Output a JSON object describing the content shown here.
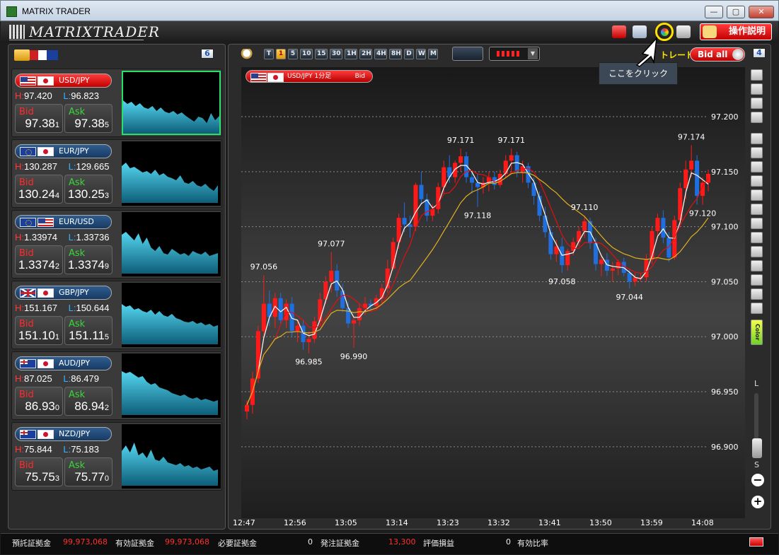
{
  "window": {
    "title": "MATRIX TRADER"
  },
  "toolbar": {
    "logo": "MATRIXTRADER",
    "help_label": "操作説明"
  },
  "left_panel": {
    "badge": "6"
  },
  "pairs": [
    {
      "symbol": "USD/JPY",
      "high": "97.420",
      "low": "96.823",
      "bid_main": "97.38",
      "bid_pip": "1",
      "ask_main": "97.38",
      "ask_pip": "5",
      "active": true
    },
    {
      "symbol": "EUR/JPY",
      "high": "130.287",
      "low": "129.665",
      "bid_main": "130.24",
      "bid_pip": "4",
      "ask_main": "130.25",
      "ask_pip": "3"
    },
    {
      "symbol": "EUR/USD",
      "high": "1.33974",
      "low": "1.33736",
      "bid_main": "1.3374",
      "bid_pip": "2",
      "ask_main": "1.3374",
      "ask_pip": "9"
    },
    {
      "symbol": "GBP/JPY",
      "high": "151.167",
      "low": "150.644",
      "bid_main": "151.10",
      "bid_pip": "1",
      "ask_main": "151.11",
      "ask_pip": "5"
    },
    {
      "symbol": "AUD/JPY",
      "high": "87.025",
      "low": "86.479",
      "bid_main": "86.93",
      "bid_pip": "0",
      "ask_main": "86.94",
      "ask_pip": "2"
    },
    {
      "symbol": "NZD/JPY",
      "high": "75.844",
      "low": "75.183",
      "bid_main": "75.75",
      "bid_pip": "3",
      "ask_main": "75.77",
      "ask_pip": "0"
    }
  ],
  "labels": {
    "h": "H:",
    "l": "L:",
    "bid": "Bid",
    "ask": "Ask"
  },
  "chart_panel": {
    "timeframes": [
      "T",
      "1",
      "5",
      "10",
      "15",
      "30",
      "1H",
      "2H",
      "4H",
      "8H",
      "D",
      "W",
      "M"
    ],
    "active_timeframe": "1",
    "pair_tag": "USD/JPY 1分足",
    "pair_tag_side": "Bid",
    "trade_label": "トレード",
    "trade_toggle": "Bid all",
    "badge": "4",
    "tooltip": "ここをクリック",
    "zoom_l": "L",
    "zoom_s": "S",
    "color_tool": "Color"
  },
  "chart_data": {
    "type": "candlestick",
    "title": "USD/JPY 1分足",
    "y_ticks": [
      "97.200",
      "97.150",
      "97.100",
      "97.050",
      "97.000",
      "96.950",
      "96.900"
    ],
    "ylim": [
      96.835,
      97.245
    ],
    "x_ticks": [
      "12:47",
      "12:56",
      "13:05",
      "13:14",
      "13:23",
      "13:32",
      "13:41",
      "13:50",
      "13:59",
      "14:08"
    ],
    "annotations": [
      {
        "label": "97.056",
        "value": 97.056,
        "i": 3
      },
      {
        "label": "96.985",
        "value": 96.985,
        "i": 11
      },
      {
        "label": "97.077",
        "value": 97.077,
        "i": 15
      },
      {
        "label": "96.990",
        "value": 96.99,
        "i": 19
      },
      {
        "label": "97.171",
        "value": 97.171,
        "i": 38
      },
      {
        "label": "97.118",
        "value": 97.118,
        "i": 41
      },
      {
        "label": "97.171",
        "value": 97.171,
        "i": 47
      },
      {
        "label": "97.110",
        "value": 97.11,
        "i": 60
      },
      {
        "label": "97.058",
        "value": 97.058,
        "i": 56
      },
      {
        "label": "97.044",
        "value": 97.044,
        "i": 68
      },
      {
        "label": "97.174",
        "value": 97.174,
        "i": 79
      },
      {
        "label": "97.120",
        "value": 97.12,
        "i": 81
      }
    ],
    "candles": [
      [
        96.932,
        96.942,
        96.925,
        96.938
      ],
      [
        96.938,
        96.968,
        96.93,
        96.962
      ],
      [
        96.962,
        97.01,
        96.958,
        97.005
      ],
      [
        97.005,
        97.056,
        97.0,
        97.03
      ],
      [
        97.03,
        97.042,
        97.01,
        97.018
      ],
      [
        97.018,
        97.04,
        97.008,
        97.035
      ],
      [
        97.035,
        97.04,
        97.012,
        97.015
      ],
      [
        97.015,
        97.034,
        97.008,
        97.03
      ],
      [
        97.03,
        97.036,
        97.0,
        97.005
      ],
      [
        97.005,
        97.015,
        96.995,
        97.01
      ],
      [
        97.01,
        97.015,
        96.988,
        96.995
      ],
      [
        96.995,
        97.005,
        96.985,
        96.998
      ],
      [
        96.998,
        97.018,
        96.994,
        97.014
      ],
      [
        97.014,
        97.04,
        97.01,
        97.034
      ],
      [
        97.034,
        97.055,
        97.03,
        97.05
      ],
      [
        97.05,
        97.077,
        97.04,
        97.06
      ],
      [
        97.06,
        97.066,
        97.036,
        97.042
      ],
      [
        97.042,
        97.048,
        97.022,
        97.026
      ],
      [
        97.026,
        97.032,
        97.008,
        97.012
      ],
      [
        97.012,
        97.018,
        96.99,
        97.015
      ],
      [
        97.015,
        97.03,
        97.01,
        97.026
      ],
      [
        97.026,
        97.036,
        97.02,
        97.03
      ],
      [
        97.03,
        97.034,
        97.024,
        97.028
      ],
      [
        97.028,
        97.038,
        97.024,
        97.035
      ],
      [
        97.035,
        97.048,
        97.03,
        97.044
      ],
      [
        97.044,
        97.07,
        97.04,
        97.062
      ],
      [
        97.062,
        97.09,
        97.06,
        97.086
      ],
      [
        97.086,
        97.112,
        97.08,
        97.108
      ],
      [
        97.108,
        97.122,
        97.095,
        97.102
      ],
      [
        97.102,
        97.11,
        97.09,
        97.1
      ],
      [
        97.1,
        97.14,
        97.096,
        97.138
      ],
      [
        97.138,
        97.15,
        97.12,
        97.125
      ],
      [
        97.125,
        97.13,
        97.105,
        97.11
      ],
      [
        97.11,
        97.12,
        97.105,
        97.116
      ],
      [
        97.116,
        97.14,
        97.112,
        97.136
      ],
      [
        97.136,
        97.16,
        97.13,
        97.154
      ],
      [
        97.154,
        97.165,
        97.14,
        97.145
      ],
      [
        97.145,
        97.16,
        97.14,
        97.158
      ],
      [
        97.158,
        97.171,
        97.15,
        97.164
      ],
      [
        97.164,
        97.168,
        97.14,
        97.145
      ],
      [
        97.145,
        97.15,
        97.13,
        97.14
      ],
      [
        97.14,
        97.148,
        97.118,
        97.136
      ],
      [
        97.136,
        97.145,
        97.13,
        97.14
      ],
      [
        97.14,
        97.15,
        97.132,
        97.145
      ],
      [
        97.145,
        97.15,
        97.134,
        97.138
      ],
      [
        97.138,
        97.152,
        97.136,
        97.148
      ],
      [
        97.148,
        97.165,
        97.145,
        97.16
      ],
      [
        97.16,
        97.171,
        97.15,
        97.165
      ],
      [
        97.165,
        97.168,
        97.145,
        97.15
      ],
      [
        97.15,
        97.16,
        97.14,
        97.155
      ],
      [
        97.155,
        97.158,
        97.135,
        97.14
      ],
      [
        97.14,
        97.145,
        97.12,
        97.128
      ],
      [
        97.128,
        97.132,
        97.105,
        97.11
      ],
      [
        97.11,
        97.118,
        97.09,
        97.095
      ],
      [
        97.095,
        97.1,
        97.07,
        97.075
      ],
      [
        97.075,
        97.088,
        97.068,
        97.082
      ],
      [
        97.082,
        97.09,
        97.058,
        97.065
      ],
      [
        97.065,
        97.08,
        97.06,
        97.078
      ],
      [
        97.078,
        97.09,
        97.074,
        97.086
      ],
      [
        97.086,
        97.1,
        97.082,
        97.096
      ],
      [
        97.096,
        97.11,
        97.09,
        97.105
      ],
      [
        97.105,
        97.108,
        97.08,
        97.085
      ],
      [
        97.085,
        97.09,
        97.06,
        97.066
      ],
      [
        97.066,
        97.075,
        97.055,
        97.07
      ],
      [
        97.07,
        97.076,
        97.055,
        97.06
      ],
      [
        97.06,
        97.068,
        97.05,
        97.062
      ],
      [
        97.062,
        97.07,
        97.056,
        97.068
      ],
      [
        97.068,
        97.072,
        97.055,
        97.058
      ],
      [
        97.058,
        97.062,
        97.044,
        97.05
      ],
      [
        97.05,
        97.058,
        97.046,
        97.054
      ],
      [
        97.054,
        97.058,
        97.05,
        97.054
      ],
      [
        97.054,
        97.075,
        97.05,
        97.07
      ],
      [
        97.07,
        97.1,
        97.066,
        97.096
      ],
      [
        97.096,
        97.112,
        97.09,
        97.108
      ],
      [
        97.108,
        97.115,
        97.085,
        97.09
      ],
      [
        97.09,
        97.095,
        97.068,
        97.072
      ],
      [
        97.072,
        97.11,
        97.07,
        97.106
      ],
      [
        97.106,
        97.14,
        97.1,
        97.135
      ],
      [
        97.135,
        97.16,
        97.125,
        97.152
      ],
      [
        97.152,
        97.174,
        97.145,
        97.16
      ],
      [
        97.16,
        97.165,
        97.12,
        97.128
      ],
      [
        97.128,
        97.145,
        97.12,
        97.14
      ],
      [
        97.14,
        97.152,
        97.132,
        97.148
      ]
    ]
  },
  "status": {
    "deposit_label": "預託証拠金",
    "deposit_value": "99,973,068",
    "effective_label": "有効証拠金",
    "effective_value": "99,973,068",
    "required_label": "必要証拠金",
    "required_value": "0",
    "order_label": "発注証拠金",
    "order_value": "13,300",
    "pl_label": "評価損益",
    "pl_value": "0",
    "ratio_label": "有効比率"
  },
  "colors": {
    "up": "#ff1a1a",
    "down": "#1f6fe0",
    "ma_fast": "#ffffff",
    "ma_mid": "#e01010",
    "ma_slow": "#e0b020",
    "spark": "#2ab3d6"
  }
}
